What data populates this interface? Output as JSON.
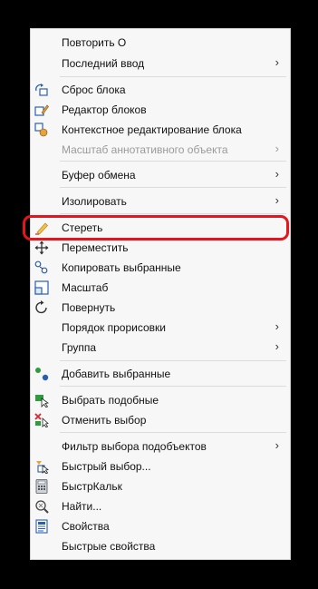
{
  "menu": {
    "items": {
      "repeat": {
        "label": "Повторить О"
      },
      "last_input": {
        "label": "Последний ввод"
      },
      "reset_block": {
        "label": "Сброс блока"
      },
      "block_editor": {
        "label": "Редактор блоков"
      },
      "inplace_edit": {
        "label": "Контекстное редактирование блока"
      },
      "annotative_scale": {
        "label": "Масштаб аннотативного объекта"
      },
      "clipboard": {
        "label": "Буфер обмена"
      },
      "isolate": {
        "label": "Изолировать"
      },
      "erase": {
        "label": "Стереть"
      },
      "move": {
        "label": "Переместить"
      },
      "copy_selection": {
        "label": "Копировать выбранные"
      },
      "scale": {
        "label": "Масштаб"
      },
      "rotate": {
        "label": "Повернуть"
      },
      "draw_order": {
        "label": "Порядок прорисовки"
      },
      "group": {
        "label": "Группа"
      },
      "add_selected": {
        "label": "Добавить выбранные"
      },
      "select_similar": {
        "label": "Выбрать подобные"
      },
      "deselect_all": {
        "label": "Отменить выбор"
      },
      "subobject_filter": {
        "label": "Фильтр выбора подобъектов"
      },
      "quick_select": {
        "label": "Быстрый выбор..."
      },
      "quickcalc": {
        "label": "БыстрКальк"
      },
      "find": {
        "label": "Найти..."
      },
      "properties": {
        "label": "Свойства"
      },
      "quick_properties": {
        "label": "Быстрые свойства"
      }
    },
    "submenu_glyph": "›"
  },
  "colors": {
    "highlight": "#e4151c",
    "menu_bg": "#f7f7f7",
    "disabled_text": "#9a9a9a"
  }
}
